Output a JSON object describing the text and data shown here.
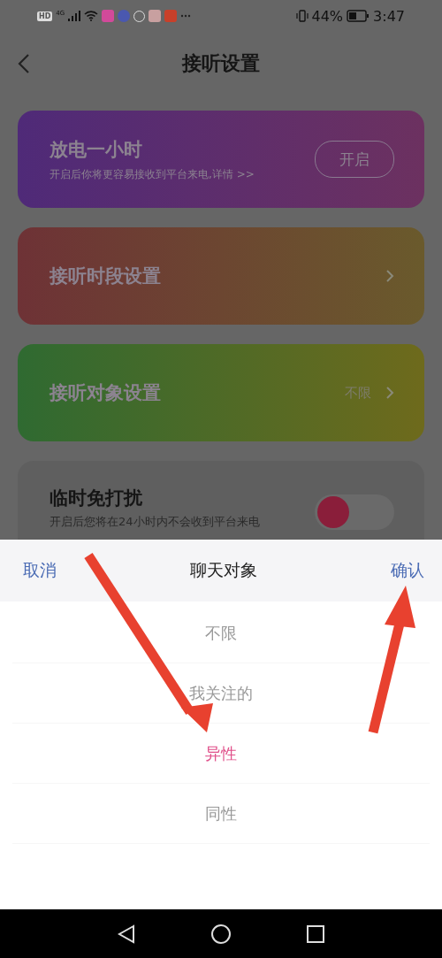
{
  "status_bar": {
    "badges": [
      "HD",
      "4G"
    ],
    "battery_percent": "44%",
    "time": "3:47"
  },
  "header": {
    "title": "接听设置"
  },
  "cards": [
    {
      "kind": "promo",
      "title": "放电一小时",
      "subtitle": "开启后你将更容易接收到平台来电,详情 >>",
      "button": "开启"
    },
    {
      "kind": "link",
      "title": "接听时段设置"
    },
    {
      "kind": "link",
      "title": "接听对象设置",
      "value": "不限"
    },
    {
      "kind": "toggle",
      "title": "临时免打扰",
      "subtitle": "开启后您将在24小时内不会收到平台来电",
      "on": false
    }
  ],
  "picker": {
    "cancel": "取消",
    "title": "聊天对象",
    "confirm": "确认",
    "options": [
      {
        "label": "不限",
        "selected": false
      },
      {
        "label": "我关注的",
        "selected": false
      },
      {
        "label": "异性",
        "selected": true
      },
      {
        "label": "同性",
        "selected": false
      }
    ]
  }
}
